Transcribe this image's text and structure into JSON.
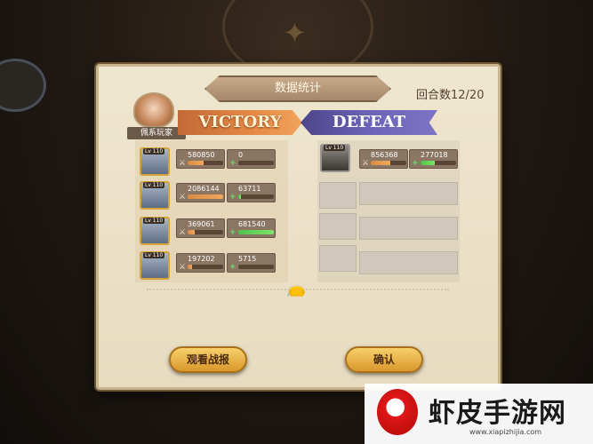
{
  "header": {
    "title": "数据统计",
    "rounds_label": "回合数",
    "rounds_value": "12/20"
  },
  "player": {
    "name": "佩系玩家"
  },
  "teams": {
    "victory": "VICTORY",
    "defeat": "DEFEAT"
  },
  "victory_heroes": [
    {
      "level": "Lv 110",
      "damage": "580850",
      "heal": "0",
      "damage_fill": 0.45,
      "heal_fill": 0.0
    },
    {
      "level": "Lv 110",
      "damage": "2086144",
      "heal": "63711",
      "damage_fill": 1.0,
      "heal_fill": 0.08
    },
    {
      "level": "Lv 110",
      "damage": "369061",
      "heal": "681540",
      "damage_fill": 0.2,
      "heal_fill": 1.0
    },
    {
      "level": "Lv 110",
      "damage": "197202",
      "heal": "5715",
      "damage_fill": 0.12,
      "heal_fill": 0.01
    }
  ],
  "defeat_heroes": [
    {
      "level": "Lv 110",
      "damage": "856368",
      "heal": "277018",
      "damage_fill": 0.55,
      "heal_fill": 0.4
    }
  ],
  "buttons": {
    "watch_replay": "观看战报",
    "confirm": "确认"
  },
  "watermark": {
    "text": "虾皮手游网",
    "url": "www.xiapizhijia.com"
  },
  "colors": {
    "victory": "#e58a46",
    "defeat": "#6c62b8",
    "damage": "#f0a85c",
    "heal": "#6de06a"
  },
  "icons": {
    "damage": "sword-icon",
    "heal": "plus-icon",
    "pouch": "pouch-icon"
  }
}
